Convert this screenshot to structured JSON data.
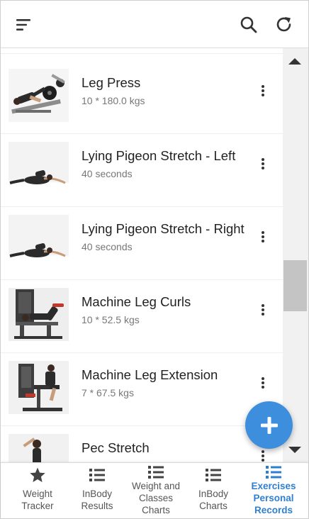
{
  "header": {
    "menu_icon": "menu-icon",
    "search_icon": "search-icon",
    "refresh_icon": "refresh-icon"
  },
  "exercises": [
    {
      "title": "Leg Press",
      "detail": "10 * 180.0 kgs",
      "thumb": "leg-press"
    },
    {
      "title": "Lying Pigeon Stretch - Left",
      "detail": "40 seconds",
      "thumb": "pigeon"
    },
    {
      "title": "Lying Pigeon Stretch - Right",
      "detail": "40 seconds",
      "thumb": "pigeon"
    },
    {
      "title": "Machine Leg Curls",
      "detail": "10 * 52.5 kgs",
      "thumb": "leg-curl"
    },
    {
      "title": "Machine Leg Extension",
      "detail": "7 * 67.5 kgs",
      "thumb": "leg-extension"
    },
    {
      "title": "Pec Stretch",
      "detail": "",
      "thumb": "pec-stretch"
    }
  ],
  "fab": {
    "icon": "plus-icon",
    "color": "#3d8fde"
  },
  "bottom_nav": [
    {
      "label": "Weight\nTracker",
      "icon": "star-icon",
      "active": false
    },
    {
      "label": "InBody\nResults",
      "icon": "list-icon",
      "active": false
    },
    {
      "label": "Weight and\nClasses\nCharts",
      "icon": "list-icon",
      "active": false
    },
    {
      "label": "InBody\nCharts",
      "icon": "list-icon",
      "active": false
    },
    {
      "label": "Exercises\nPersonal\nRecords",
      "icon": "list-icon",
      "active": true
    }
  ],
  "colors": {
    "accent": "#2f7fd1",
    "icon": "#333333",
    "subtext": "#777777"
  }
}
